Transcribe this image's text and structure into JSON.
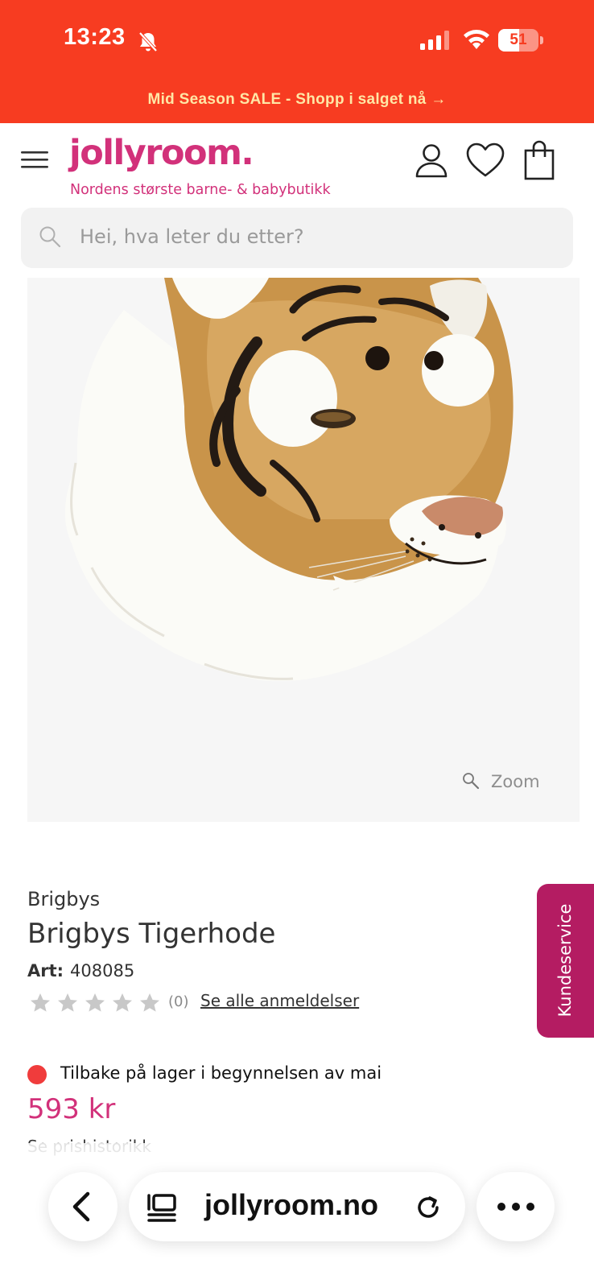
{
  "status_bar": {
    "time": "13:23",
    "battery": "51",
    "battery_level": 0.51,
    "background_color": "#f73c21"
  },
  "promo_banner": {
    "text": "Mid Season SALE - Shopp i salget nå →"
  },
  "header": {
    "logo": "jollyroom.",
    "tagline": "Nordens største barne- & babybutikk",
    "brand_color": "#d2317a",
    "icons": [
      "menu-icon",
      "account-icon",
      "heart-icon",
      "bag-icon"
    ]
  },
  "search": {
    "placeholder": "Hei, hva leter du etter?"
  },
  "product": {
    "zoom_label": "Zoom",
    "brand": "Brigbys",
    "title": "Brigbys Tigerhode",
    "art_label": "Art:",
    "art_number": "408085",
    "rating_stars": 0,
    "review_count": "(0)",
    "reviews_link": "Se alle anmeldelser",
    "stock_status": "Tilbake på lager i begynnelsen av mai",
    "stock_color": "#f03c3c",
    "price": "593 kr",
    "price_history_link": "Se prishistorikk"
  },
  "side_tab": {
    "label": "Kundeservice",
    "color": "#b41c62"
  },
  "browser_bar": {
    "url": "jollyroom.no",
    "icons": [
      "back-icon",
      "tabs-icon",
      "reload-icon",
      "more-icon"
    ]
  }
}
